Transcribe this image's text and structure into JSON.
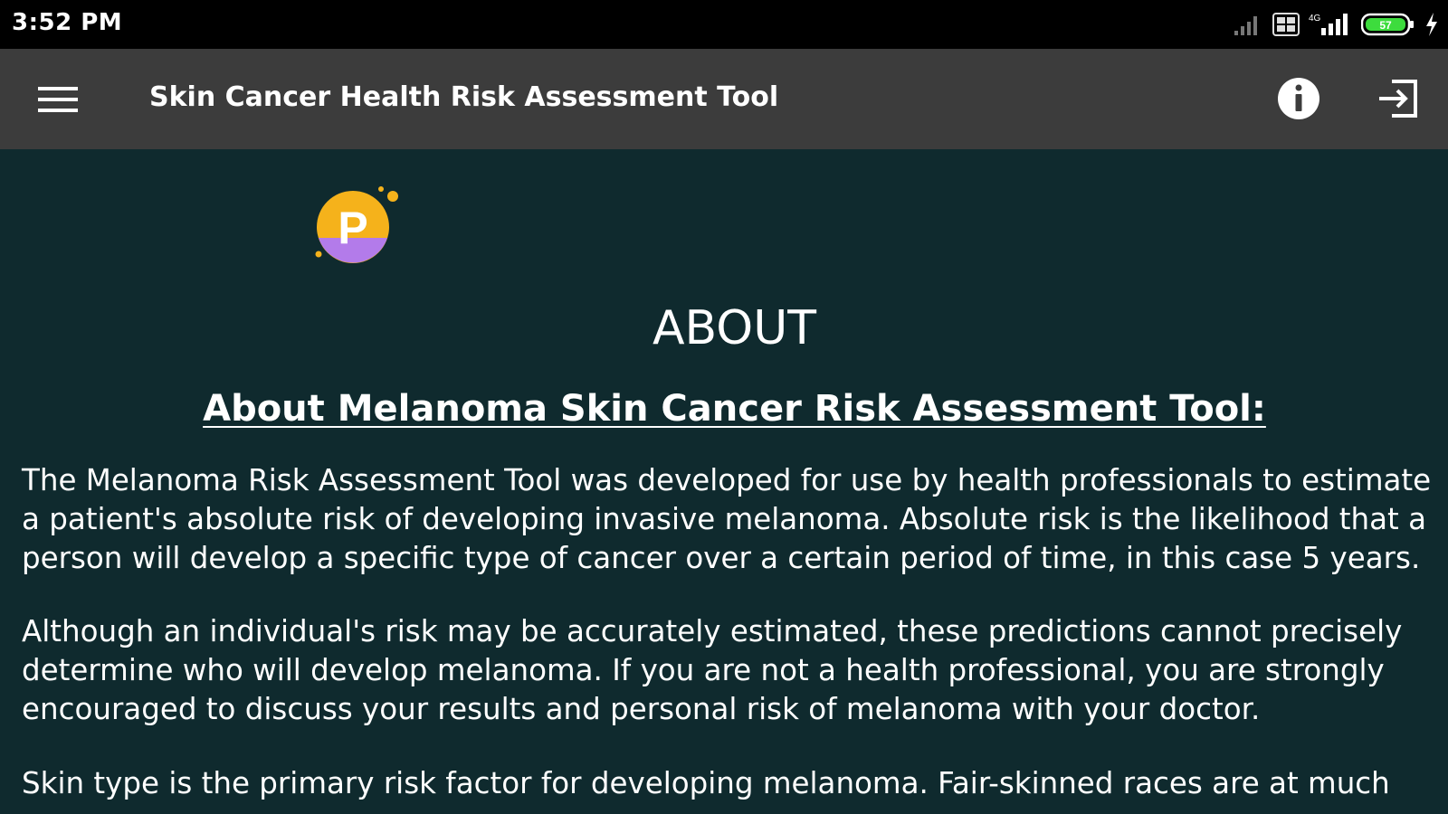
{
  "status_bar": {
    "time": "3:52 PM",
    "battery": "57",
    "icons": [
      "signal-weak-icon",
      "data-icon",
      "4g-signal-icon",
      "battery-icon",
      "charging-icon"
    ]
  },
  "app_bar": {
    "title": "Skin Cancer Health Risk Assessment Tool",
    "icons": [
      "menu-icon",
      "info-icon",
      "logout-icon"
    ]
  },
  "content": {
    "logo_letter": "P",
    "heading": "ABOUT",
    "subheading": "About Melanoma Skin Cancer Risk Assessment Tool:",
    "paragraphs": [
      "The Melanoma Risk Assessment Tool was developed for use by health professionals to estimate a patient's absolute risk of developing invasive melanoma. Absolute risk is the likelihood that a person will develop a specific type of cancer over a certain period of time, in this case 5 years.",
      "Although an individual's risk may be accurately estimated, these predictions cannot precisely determine who will develop melanoma. If you are not a health professional, you are strongly encouraged to discuss your results and personal risk of melanoma with your doctor.",
      "Skin type is the primary risk factor for developing melanoma. Fair-skinned races are at much"
    ]
  },
  "colors": {
    "status_bar_bg": "#000000",
    "app_bar_bg": "#3c3c3c",
    "content_bg": "#0f2a2e",
    "text": "#ffffff",
    "logo_yellow": "#f5b21b",
    "logo_purple": "#b37bea",
    "battery_green": "#3ddc3d"
  }
}
